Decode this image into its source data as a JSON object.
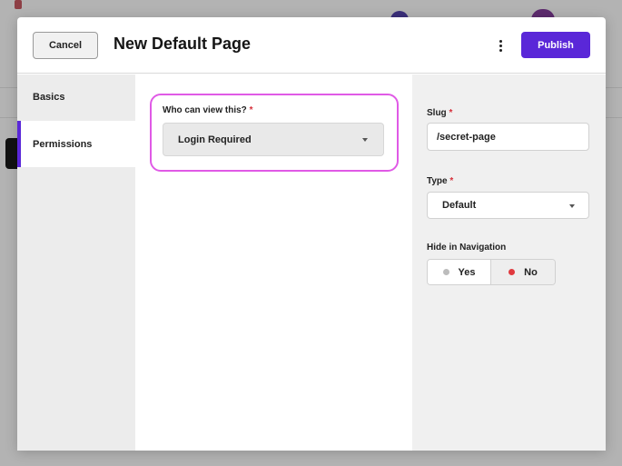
{
  "colors": {
    "accent": "#5a27d8",
    "focus": "#e05ae6",
    "required": "#d62f3a",
    "active_dot": "#e0393e",
    "inactive_dot": "#bcbcbc"
  },
  "header": {
    "cancel_label": "Cancel",
    "title": "New Default Page",
    "more_icon": "more-vertical-icon",
    "publish_label": "Publish"
  },
  "tabs": [
    {
      "label": "Basics",
      "active": false
    },
    {
      "label": "Permissions",
      "active": true
    }
  ],
  "permissions": {
    "label": "Who can view this?",
    "required_mark": "*",
    "value": "Login Required"
  },
  "sidebar": {
    "slug": {
      "label": "Slug",
      "required_mark": "*",
      "value": "/secret-page"
    },
    "type": {
      "label": "Type",
      "required_mark": "*",
      "value": "Default"
    },
    "hide_nav": {
      "label": "Hide in Navigation",
      "yes_label": "Yes",
      "no_label": "No",
      "selected": "No"
    }
  }
}
